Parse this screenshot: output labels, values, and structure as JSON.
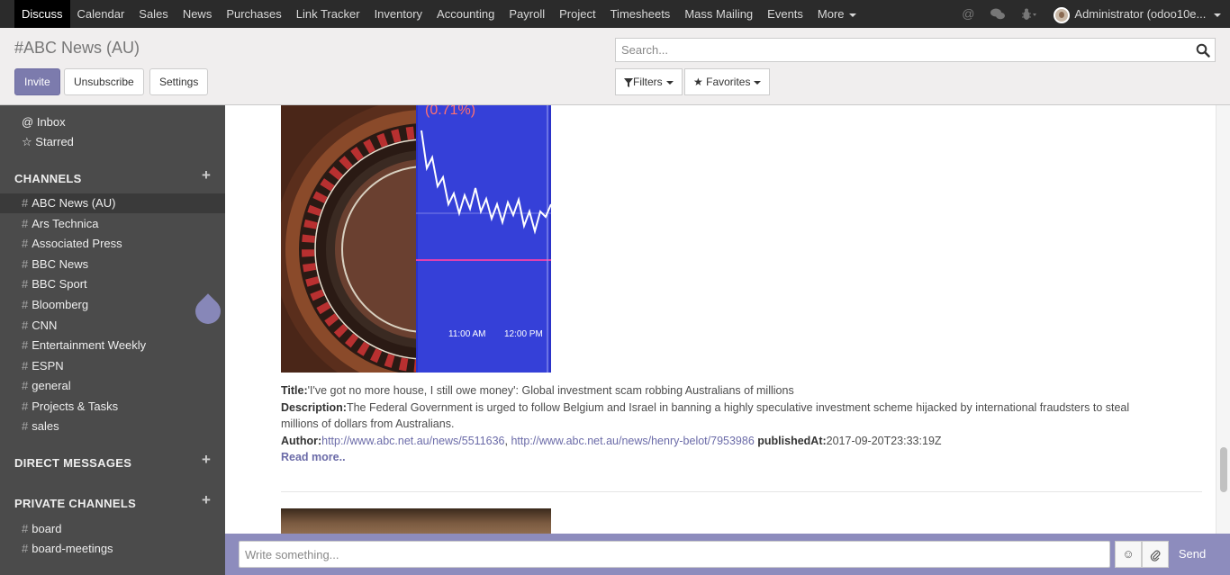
{
  "topbar": {
    "apps": [
      "Discuss",
      "Calendar",
      "Sales",
      "News",
      "Purchases",
      "Link Tracker",
      "Inventory",
      "Accounting",
      "Payroll",
      "Project",
      "Timesheets",
      "Mass Mailing",
      "Events"
    ],
    "more_label": "More",
    "user_name": "Administrator (odoo10e..."
  },
  "control_panel": {
    "title": "#ABC News (AU)",
    "invite_label": "Invite",
    "unsubscribe_label": "Unsubscribe",
    "settings_label": "Settings",
    "search_placeholder": "Search...",
    "filters_label": "Filters",
    "favorites_label": "Favorites"
  },
  "sidebar": {
    "inbox_label": "Inbox",
    "starred_label": "Starred",
    "channels_header": "CHANNELS",
    "channels": [
      "ABC News (AU)",
      "Ars Technica",
      "Associated Press",
      "BBC News",
      "BBC Sport",
      "Bloomberg",
      "CNN",
      "Entertainment Weekly",
      "ESPN",
      "general",
      "Projects & Tasks",
      "sales"
    ],
    "direct_messages_header": "DIRECT MESSAGES",
    "private_channels_header": "PRIVATE CHANNELS",
    "private_channels": [
      "board",
      "board-meetings"
    ]
  },
  "article": {
    "title_label": "Title:",
    "title": "'I've got no more house, I still owe money': Global investment scam robbing Australians of millions",
    "description_label": "Description:",
    "description_line1": "The Federal Government is urged to follow Belgium and Israel in banning a highly speculative investment scheme hijacked by international fraudsters to steal",
    "description_line2": "millions of dollars from Australians.",
    "author_label": "Author:",
    "author_link1": "http://www.abc.net.au/news/5511636",
    "author_separator": ", ",
    "author_link2": "http://www.abc.net.au/news/henry-belot/7953986",
    "published_label": "publishedAt:",
    "published_at": "2017-09-20T23:33:19Z",
    "read_more": "Read more..",
    "image_text": {
      "pct": "(0.71%)",
      "time1": "11:00 AM",
      "time2": "12:00 PM"
    }
  },
  "composer": {
    "placeholder": "Write something...",
    "send_label": "Send"
  }
}
